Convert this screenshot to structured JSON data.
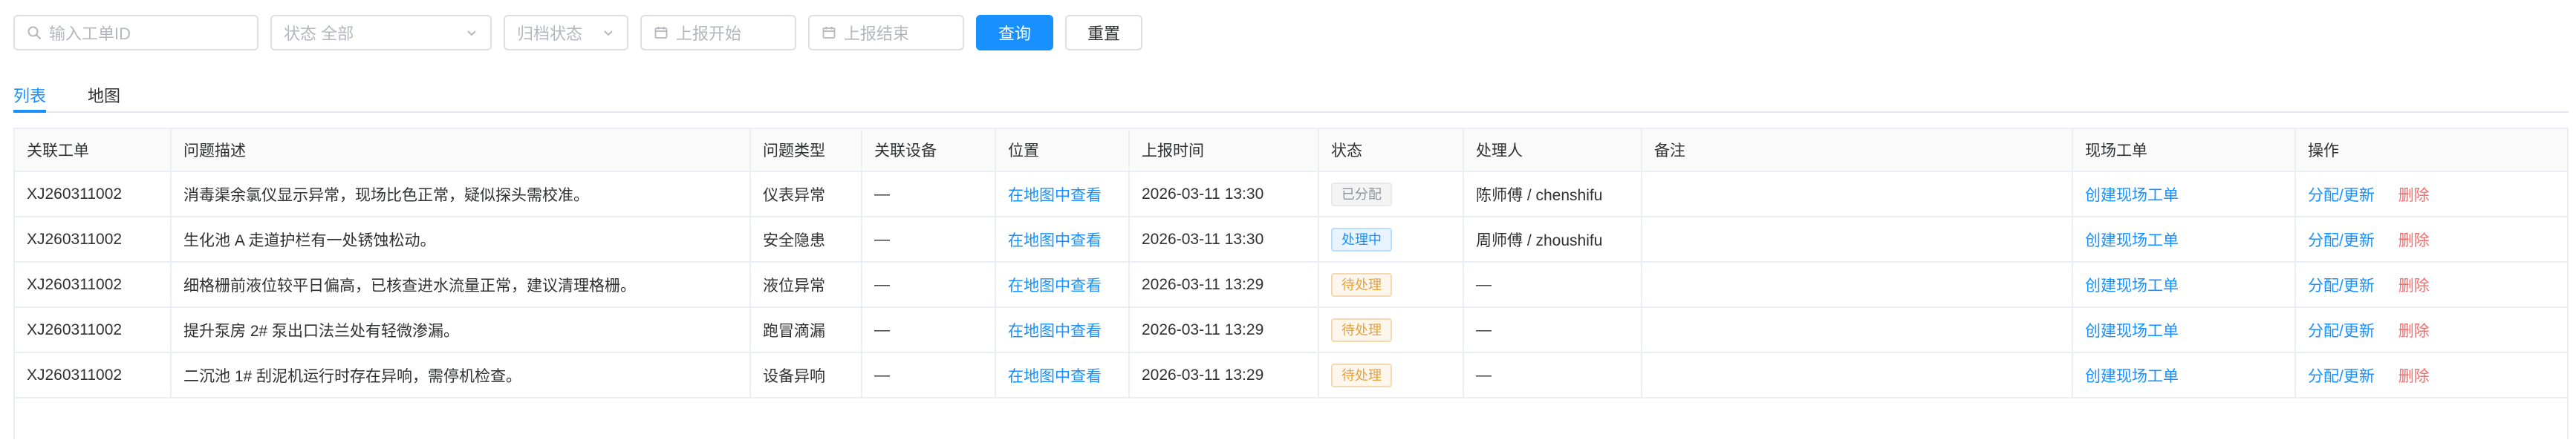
{
  "filters": {
    "search_placeholder": "输入工单ID",
    "status_placeholder": "状态 全部",
    "archive_placeholder": "归档状态",
    "start_placeholder": "上报开始",
    "end_placeholder": "上报结束",
    "query_label": "查询",
    "reset_label": "重置"
  },
  "tabs": [
    {
      "label": "列表",
      "active": true
    },
    {
      "label": "地图",
      "active": false
    }
  ],
  "table": {
    "columns": [
      "关联工单",
      "问题描述",
      "问题类型",
      "关联设备",
      "位置",
      "上报时间",
      "状态",
      "处理人",
      "备注",
      "现场工单",
      "操作"
    ],
    "rows": [
      {
        "order": "XJ260311002",
        "desc": "消毒渠余氯仪显示异常，现场比色正常，疑似探头需校准。",
        "type": "仪表异常",
        "device": "—",
        "location": "在地图中查看",
        "time": "2026-03-11 13:30",
        "status": "已分配",
        "status_kind": "assigned",
        "handler": "陈师傅 / chenshifu",
        "note": "",
        "site_order": "创建现场工单",
        "op_edit": "分配/更新",
        "op_delete": "删除"
      },
      {
        "order": "XJ260311002",
        "desc": "生化池 A 走道护栏有一处锈蚀松动。",
        "type": "安全隐患",
        "device": "—",
        "location": "在地图中查看",
        "time": "2026-03-11 13:30",
        "status": "处理中",
        "status_kind": "processing",
        "handler": "周师傅 / zhoushifu",
        "note": "",
        "site_order": "创建现场工单",
        "op_edit": "分配/更新",
        "op_delete": "删除"
      },
      {
        "order": "XJ260311002",
        "desc": "细格栅前液位较平日偏高，已核查进水流量正常，建议清理格栅。",
        "type": "液位异常",
        "device": "—",
        "location": "在地图中查看",
        "time": "2026-03-11 13:29",
        "status": "待处理",
        "status_kind": "pending",
        "handler": "—",
        "note": "",
        "site_order": "创建现场工单",
        "op_edit": "分配/更新",
        "op_delete": "删除"
      },
      {
        "order": "XJ260311002",
        "desc": "提升泵房 2# 泵出口法兰处有轻微渗漏。",
        "type": "跑冒滴漏",
        "device": "—",
        "location": "在地图中查看",
        "time": "2026-03-11 13:29",
        "status": "待处理",
        "status_kind": "pending",
        "handler": "—",
        "note": "",
        "site_order": "创建现场工单",
        "op_edit": "分配/更新",
        "op_delete": "删除"
      },
      {
        "order": "XJ260311002",
        "desc": "二沉池 1# 刮泥机运行时存在异响，需停机检查。",
        "type": "设备异响",
        "device": "—",
        "location": "在地图中查看",
        "time": "2026-03-11 13:29",
        "status": "待处理",
        "status_kind": "pending",
        "handler": "—",
        "note": "",
        "site_order": "创建现场工单",
        "op_edit": "分配/更新",
        "op_delete": "删除"
      }
    ]
  },
  "colors": {
    "primary": "#1890ff",
    "danger": "#f56c6c",
    "border": "#ebeef5"
  },
  "icons": {
    "search": "search-icon",
    "chevron": "chevron-down-icon",
    "calendar": "calendar-icon"
  }
}
